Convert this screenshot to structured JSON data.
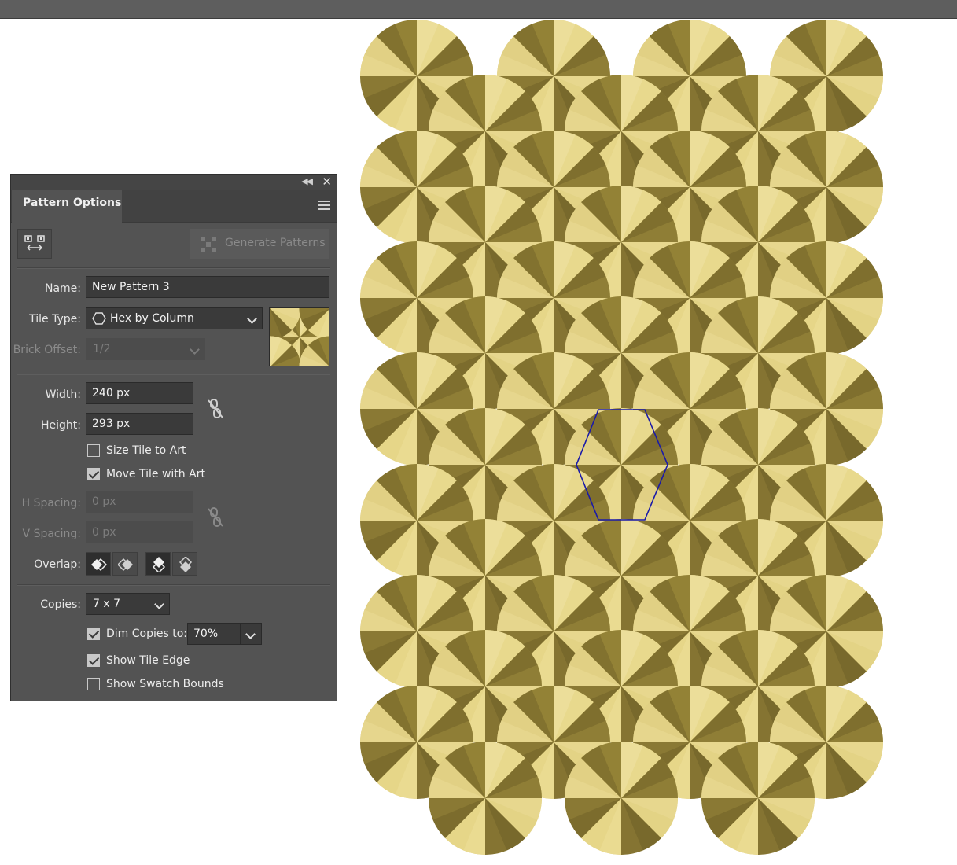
{
  "panel": {
    "tab_label": "Pattern Options",
    "generate_patterns_label": "Generate Patterns",
    "name_label": "Name:",
    "name_value": "New Pattern 3",
    "tile_type_label": "Tile Type:",
    "tile_type_value": "Hex by Column",
    "brick_offset_label": "Brick Offset:",
    "brick_offset_value": "1/2",
    "width_label": "Width:",
    "width_value": "240 px",
    "height_label": "Height:",
    "height_value": "293 px",
    "size_tile_to_art_label": "Size Tile to Art",
    "size_tile_to_art_checked": false,
    "move_tile_with_art_label": "Move Tile with Art",
    "move_tile_with_art_checked": true,
    "h_spacing_label": "H Spacing:",
    "h_spacing_value": "0 px",
    "v_spacing_label": "V Spacing:",
    "v_spacing_value": "0 px",
    "overlap_label": "Overlap:",
    "copies_label": "Copies:",
    "copies_value": "7 x 7",
    "dim_copies_label": "Dim Copies to:",
    "dim_copies_checked": true,
    "dim_copies_value": "70%",
    "show_tile_edge_label": "Show Tile Edge",
    "show_tile_edge_checked": true,
    "show_swatch_bounds_label": "Show Swatch Bounds",
    "show_swatch_bounds_checked": false
  },
  "colors": {
    "gold_light": "#e6d78a",
    "gold_dark": "#7a6a2c",
    "tile_edge": "#1a1aa8",
    "panel_bg": "#535353"
  }
}
